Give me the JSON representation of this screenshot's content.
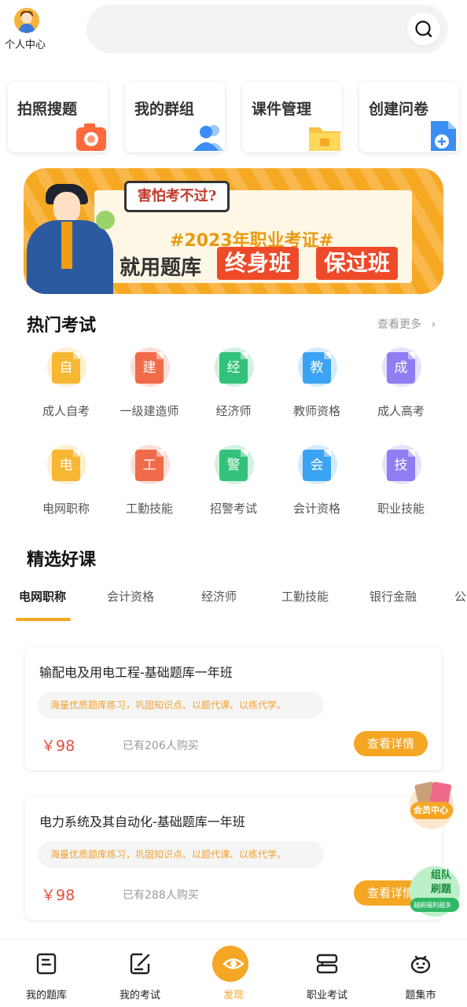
{
  "header": {
    "profile_label": "个人中心",
    "search_icon": "search-icon"
  },
  "quick_actions": [
    {
      "label": "拍照搜题",
      "icon": "camera-icon",
      "color": "#ff6a3d"
    },
    {
      "label": "我的群组",
      "icon": "group-icon",
      "color": "#3a8ef6"
    },
    {
      "label": "课件管理",
      "icon": "folder-icon",
      "color": "#f6c343"
    },
    {
      "label": "创建问卷",
      "icon": "add-document-icon",
      "color": "#3a8ef6"
    }
  ],
  "banner": {
    "bubble": "害怕考不过?",
    "year_text": "#2023年职业考证#",
    "slogan": "就用题库",
    "tag1": "终身班",
    "tag2": "保过班"
  },
  "hot_exams": {
    "title": "热门考试",
    "see_more": "查看更多",
    "items": [
      {
        "char": "自",
        "label": "成人自考",
        "color": "#f7b733"
      },
      {
        "char": "建",
        "label": "一级建造师",
        "color": "#f16b4a"
      },
      {
        "char": "经",
        "label": "经济师",
        "color": "#33c27a"
      },
      {
        "char": "教",
        "label": "教师资格",
        "color": "#3ba3f3"
      },
      {
        "char": "成",
        "label": "成人高考",
        "color": "#8f7df2"
      },
      {
        "char": "电",
        "label": "电网职称",
        "color": "#f7b733"
      },
      {
        "char": "工",
        "label": "工勤技能",
        "color": "#f16b4a"
      },
      {
        "char": "警",
        "label": "招警考试",
        "color": "#33c27a"
      },
      {
        "char": "会",
        "label": "会计资格",
        "color": "#3ba3f3"
      },
      {
        "char": "技",
        "label": "职业技能",
        "color": "#8f7df2"
      }
    ]
  },
  "courses_section": {
    "title": "精选好课",
    "tabs": [
      "电网职称",
      "会计资格",
      "经济师",
      "工勤技能",
      "银行金融",
      "公"
    ],
    "active_tab": 0
  },
  "courses": [
    {
      "title": "输配电及用电工程-基础题库一年班",
      "desc": "海量优质题库练习，巩固知识点、以题代课、以练代学。",
      "price": "￥98",
      "bought": "已有206人购买",
      "button": "查看详情"
    },
    {
      "title": "电力系统及其自动化-基础题库一年班",
      "desc": "海量优质题库练习，巩固知识点、以题代课、以练代学。",
      "price": "￥98",
      "bought": "已有288人购买",
      "button": "查看详情"
    }
  ],
  "floating": {
    "vip_label": "会员中心",
    "team_line1": "组队",
    "team_line2": "刷题",
    "team_line3": "越刷福利越多"
  },
  "bottom_nav": [
    {
      "label": "我的题库",
      "icon": "book-icon"
    },
    {
      "label": "我的考试",
      "icon": "edit-icon"
    },
    {
      "label": "发现",
      "icon": "eye-icon",
      "active": true
    },
    {
      "label": "职业考试",
      "icon": "stack-icon"
    },
    {
      "label": "题集市",
      "icon": "piggy-icon"
    }
  ],
  "colors": {
    "accent": "#f5a623",
    "price": "#e84d3d"
  }
}
